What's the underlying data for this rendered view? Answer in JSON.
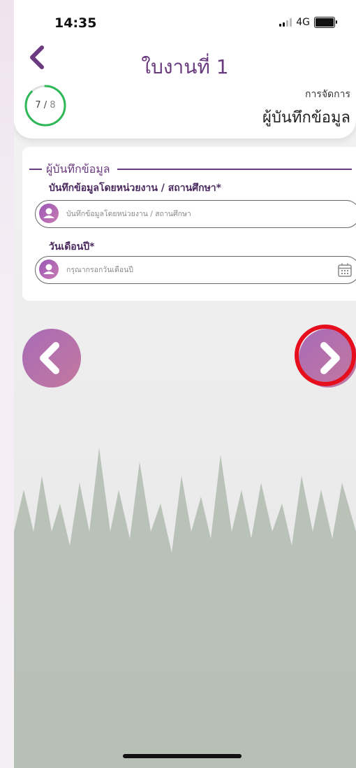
{
  "status_bar": {
    "time": "14:35",
    "network": "4G"
  },
  "header": {
    "title": "ใบงานที่ 1",
    "progress": {
      "current": "7",
      "total": "8",
      "separator": "/",
      "fraction": 0.875
    },
    "section_label": "การจัดการ",
    "section_value": "ผู้บันทึกข้อมูล"
  },
  "form": {
    "legend": "ผู้บันทึกข้อมูล",
    "fields": [
      {
        "label": "บันทึกข้อมูลโดยหน่วยงาน / สถานศึกษา*",
        "placeholder": "บันทึกข้อมูลโดยหน่วยงาน / สถานศึกษา",
        "value": ""
      },
      {
        "label": "วันเดือนปี*",
        "placeholder": "กรุณากรอกวันเดือนปี",
        "value": ""
      }
    ]
  },
  "colors": {
    "accent": "#6b3b80",
    "progress_ring": "#2eb857",
    "nav_button": "#b06fb0",
    "highlight_ring": "#e60d1c"
  },
  "icons": {
    "back": "chevron-left-icon",
    "field_avatar": "user-icon",
    "calendar": "calendar-icon",
    "prev": "chevron-left-icon",
    "next": "chevron-right-icon"
  }
}
